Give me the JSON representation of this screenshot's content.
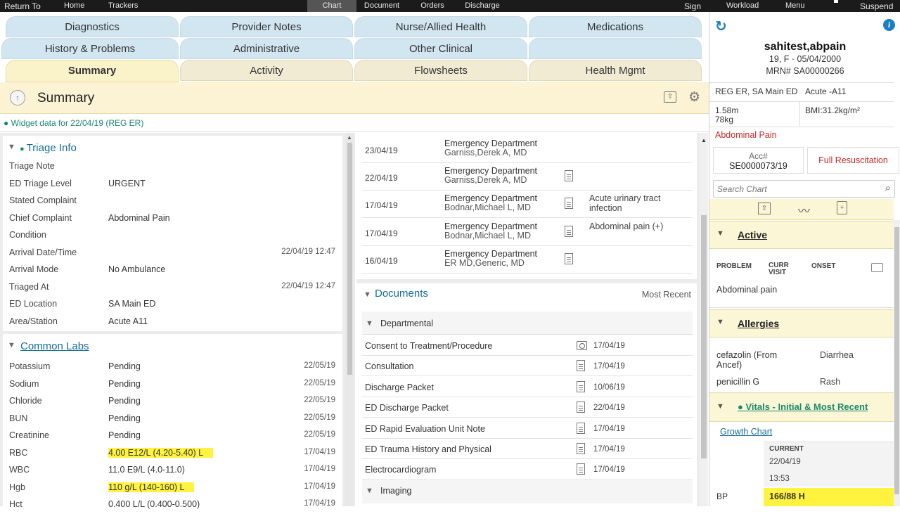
{
  "topbar": {
    "return_to": "Return To",
    "home": "Home",
    "trackers": "Trackers",
    "chart": "Chart",
    "document": "Document",
    "orders": "Orders",
    "discharge": "Discharge",
    "sign": "Sign",
    "workload": "Workload",
    "menu": "Menu",
    "suspend": "Suspend"
  },
  "tabs": {
    "diagnostics": "Diagnostics",
    "provider_notes": "Provider Notes",
    "nurse_allied": "Nurse/Allied Health",
    "medications": "Medications",
    "history_problems": "History & Problems",
    "administrative": "Administrative",
    "other_clinical": "Other Clinical",
    "summary": "Summary",
    "activity": "Activity",
    "flowsheets": "Flowsheets",
    "health_mgmt": "Health Mgmt"
  },
  "page": {
    "title": "Summary",
    "widget_data": "Widget data for 22/04/19 (REG ER)"
  },
  "triage": {
    "title": "Triage Info",
    "rows": [
      {
        "label": "Triage Note",
        "value": "",
        "date": ""
      },
      {
        "label": "ED Triage Level",
        "value": "URGENT",
        "date": ""
      },
      {
        "label": "Stated Complaint",
        "value": "",
        "date": ""
      },
      {
        "label": "Chief Complaint",
        "value": "Abdominal Pain",
        "date": ""
      },
      {
        "label": "Condition",
        "value": "",
        "date": ""
      },
      {
        "label": "Arrival Date/Time",
        "value": "",
        "date": "22/04/19 12:47"
      },
      {
        "label": "Arrival Mode",
        "value": "No Ambulance",
        "date": ""
      },
      {
        "label": "Triaged At",
        "value": "",
        "date": "22/04/19 12:47"
      },
      {
        "label": "ED Location",
        "value": "SA Main ED",
        "date": ""
      },
      {
        "label": "Area/Station",
        "value": "Acute A11",
        "date": ""
      }
    ]
  },
  "labs": {
    "title": "Common Labs",
    "rows": [
      {
        "label": "Potassium",
        "value": "Pending",
        "date": "22/05/19"
      },
      {
        "label": "Sodium",
        "value": "Pending",
        "date": "22/05/19"
      },
      {
        "label": "Chloride",
        "value": "Pending",
        "date": "22/05/19"
      },
      {
        "label": "BUN",
        "value": "Pending",
        "date": "22/05/19"
      },
      {
        "label": "Creatinine",
        "value": "Pending",
        "date": "22/05/19"
      },
      {
        "label": "RBC",
        "value": "4.00 E12/L (4.20-5.40) L",
        "date": "17/04/19"
      },
      {
        "label": "WBC",
        "value": "11.0 E9/L (4.0-11.0)",
        "date": "17/04/19"
      },
      {
        "label": "Hgb",
        "value": "110 g/L (140-160) L",
        "date": "17/04/19"
      },
      {
        "label": "Hct",
        "value": "0.400 L/L (0.400-0.500)",
        "date": "17/04/19"
      }
    ]
  },
  "encounters": [
    {
      "date": "23/04/19",
      "dept": "Emergency Department",
      "provider": "Garniss,Derek A, MD",
      "reason": ""
    },
    {
      "date": "22/04/19",
      "dept": "Emergency Department",
      "provider": "Garniss,Derek A, MD",
      "reason": ""
    },
    {
      "date": "17/04/19",
      "dept": "Emergency Department",
      "provider": "Bodnar,Michael L, MD",
      "reason": "Acute urinary tract infection"
    },
    {
      "date": "17/04/19",
      "dept": "Emergency Department",
      "provider": "Bodnar,Michael L, MD",
      "reason": "Abdominal pain (+)"
    },
    {
      "date": "16/04/19",
      "dept": "Emergency Department",
      "provider": "ER MD,Generic, MD",
      "reason": ""
    }
  ],
  "documents": {
    "title": "Documents",
    "filter": "Most Recent",
    "group1": "Departmental",
    "group2": "Imaging",
    "rows": [
      {
        "name": "Consent to Treatment/Procedure",
        "date": "17/04/19",
        "icon": "camera-icon"
      },
      {
        "name": "Consultation",
        "date": "17/04/19",
        "icon": "document-icon"
      },
      {
        "name": "Discharge Packet",
        "date": "10/06/19",
        "icon": "document-icon"
      },
      {
        "name": "ED Discharge Packet",
        "date": "22/04/19",
        "icon": "document-icon"
      },
      {
        "name": "ED Rapid Evaluation Unit Note",
        "date": "17/04/19",
        "icon": "document-icon"
      },
      {
        "name": "ED Trauma History and Physical",
        "date": "17/04/19",
        "icon": "document-icon"
      },
      {
        "name": "Electrocardiogram",
        "date": "17/04/19",
        "icon": "document-icon"
      }
    ]
  },
  "patient": {
    "name": "sahitest,abpain",
    "age_sex_dob": "19, F · 05/04/2000",
    "mrn": "MRN# SA00000266",
    "location": "REG ER, SA Main ED",
    "bed": "Acute -A11",
    "height": "1.58m",
    "weight": "78kg",
    "bmi": "BMI:31.2kg/m²",
    "problem": "Abdominal Pain",
    "acc_label": "Acc#",
    "acc_value": "SE0000073/19",
    "code_status": "Full Resuscitation",
    "search_placeholder": "Search Chart"
  },
  "active": {
    "title": "Active",
    "col_problem": "PROBLEM",
    "col_curr": "CURR VISIT",
    "col_onset": "ONSET",
    "problem": "Abdominal pain"
  },
  "allergies": {
    "title": "Allergies",
    "rows": [
      {
        "allergen": "cefazolin (From Ancef)",
        "reaction": "Diarrhea"
      },
      {
        "allergen": "penicillin G",
        "reaction": "Rash"
      }
    ]
  },
  "vitals": {
    "title": "Vitals - Initial & Most Recent",
    "growth_chart": "Growth Chart",
    "col_current": "CURRENT",
    "date": "22/04/19",
    "time": "13:53",
    "bp_label": "BP",
    "bp_value": "166/88 H"
  },
  "colors": {
    "accent": "#146d96",
    "highlight": "#fff33f",
    "alert": "#c62828",
    "green": "#1a8a6c"
  }
}
